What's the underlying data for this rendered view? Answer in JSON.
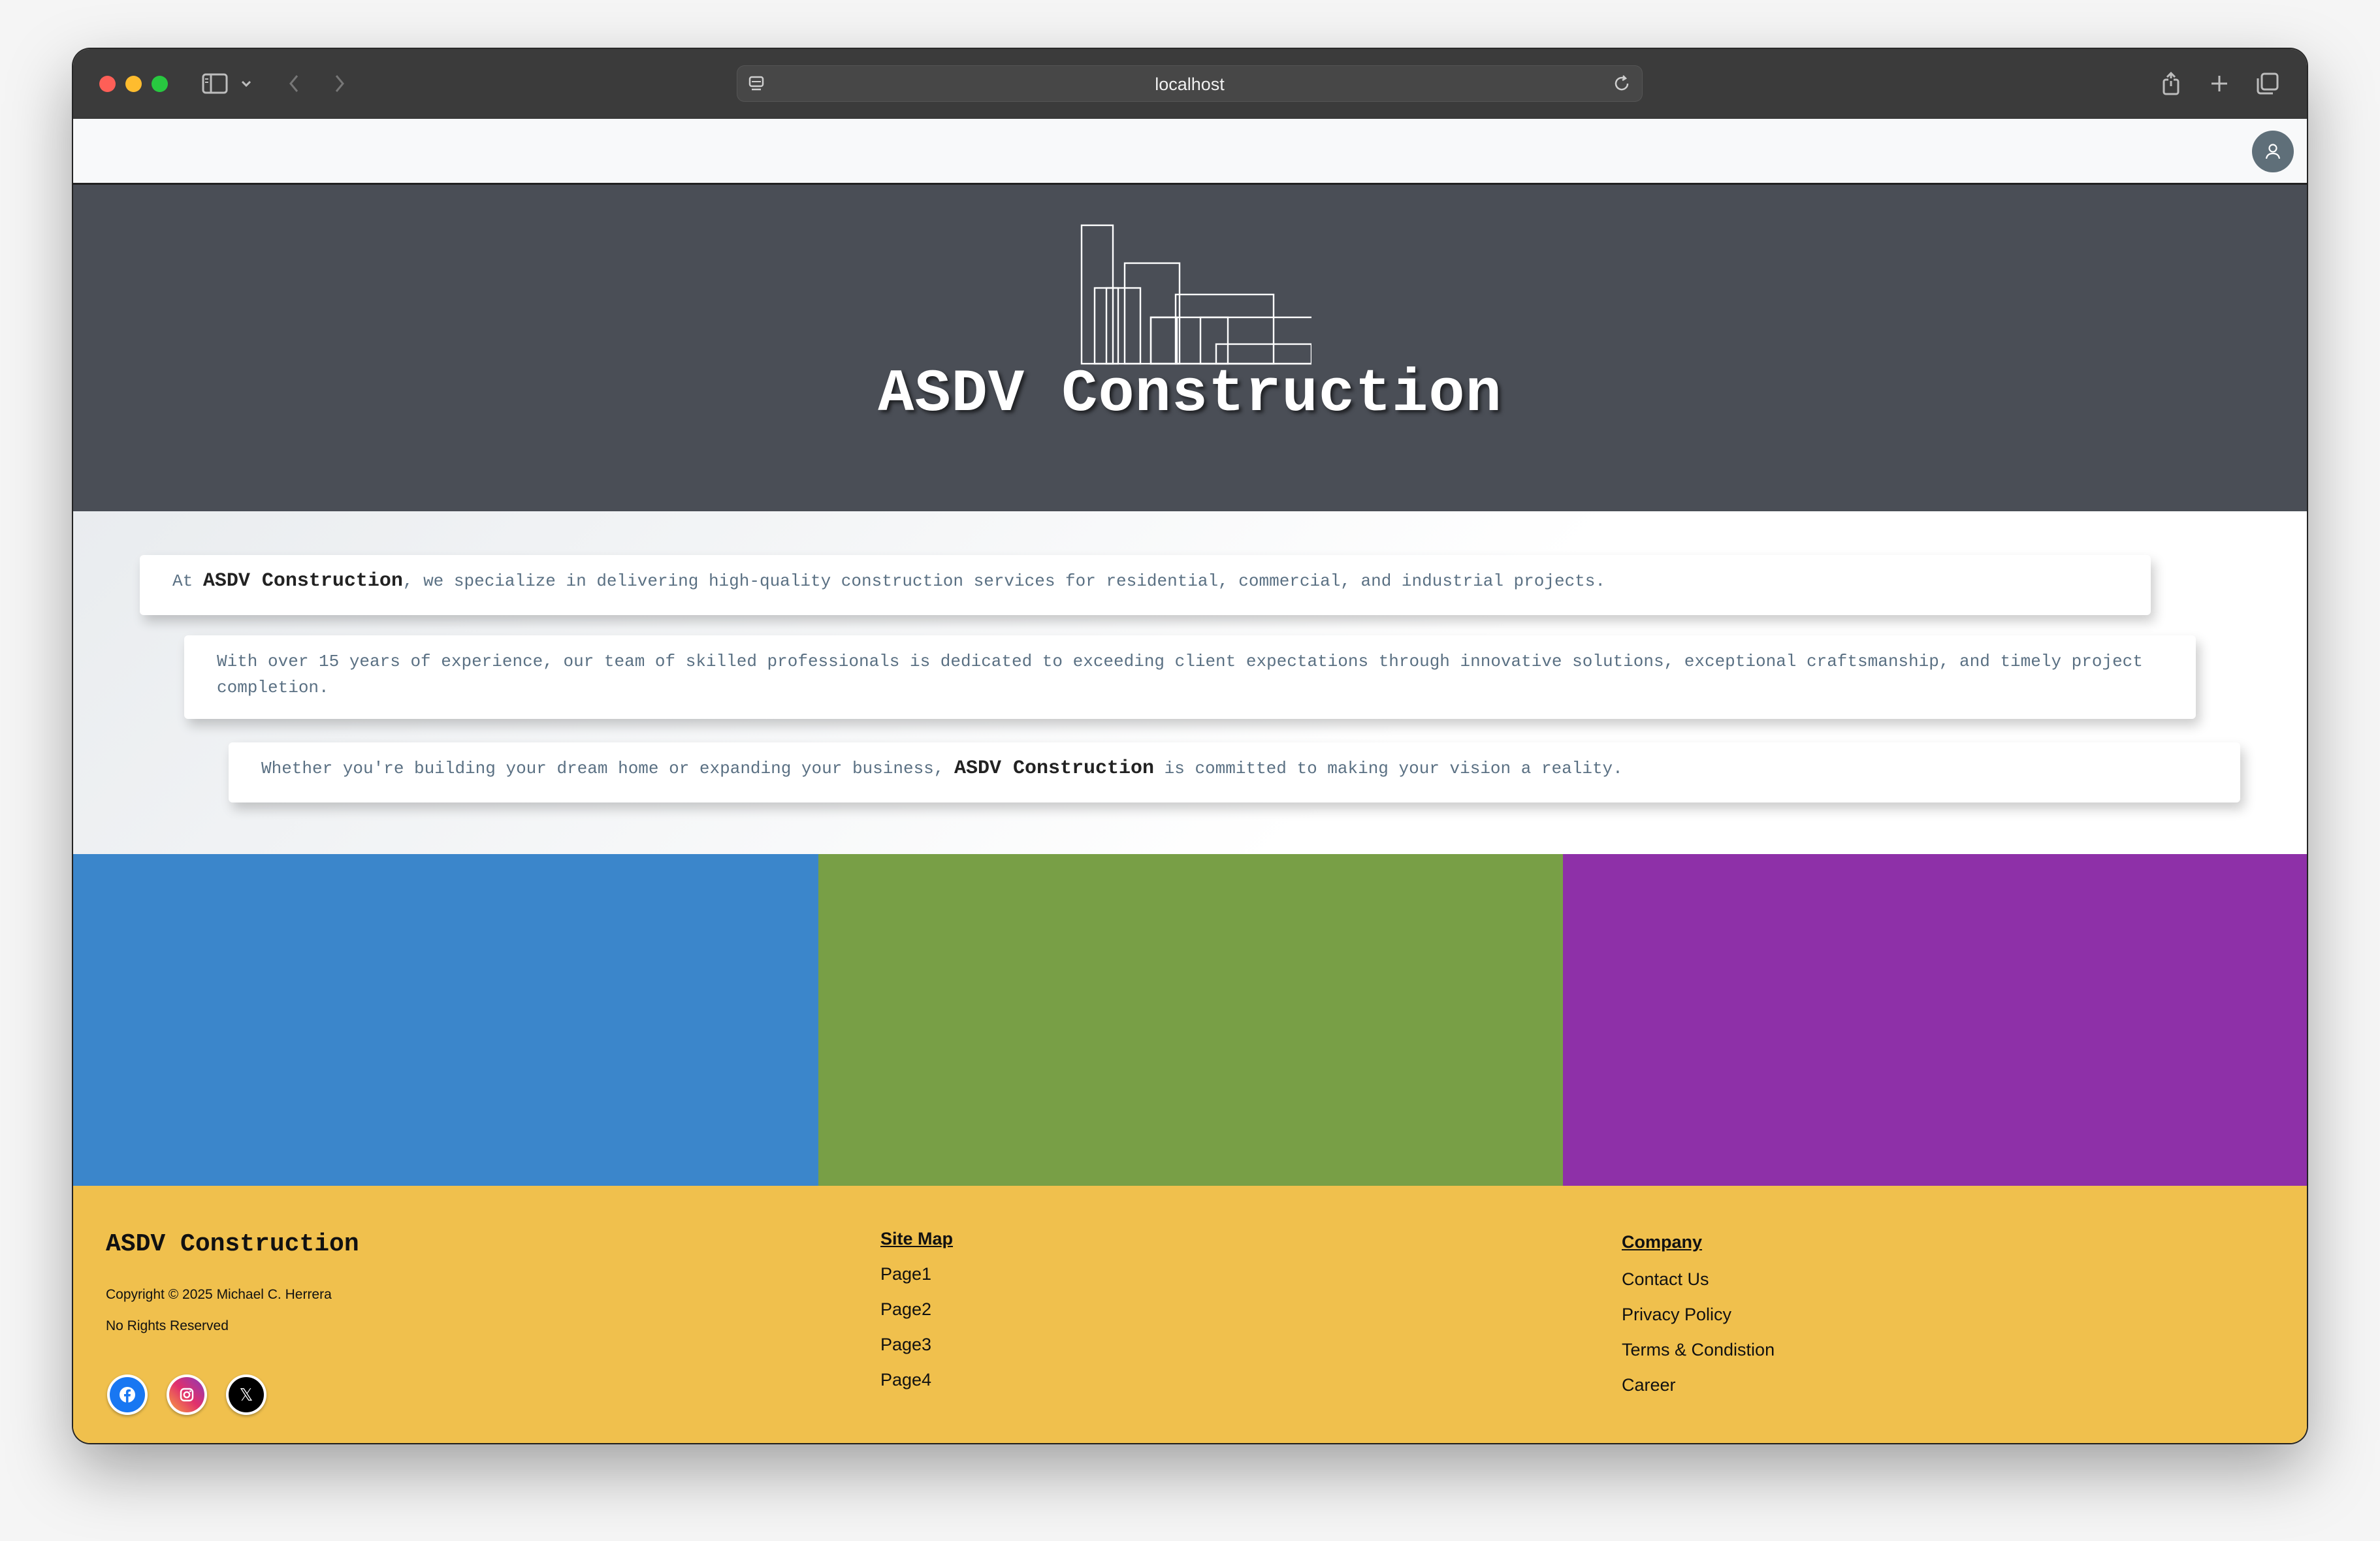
{
  "browser": {
    "url": "localhost"
  },
  "hero": {
    "title": "ASDV Construction"
  },
  "about": {
    "card1": {
      "pre": "At ",
      "brand": "ASDV Construction",
      "post": ", we specialize in delivering high-quality construction services for residential, commercial, and industrial projects."
    },
    "card2": {
      "text": "With over 15 years of experience, our team of skilled professionals is dedicated to exceeding client expectations through innovative solutions, exceptional craftsmanship, and timely project completion."
    },
    "card3": {
      "pre": "Whether you're building your dream home or expanding your business, ",
      "brand": "ASDV Construction",
      "post": " is committed to making your vision a reality."
    }
  },
  "panels": {
    "colors": [
      "#3b86cb",
      "#789f46",
      "#8e30a8"
    ]
  },
  "footer": {
    "brand": "ASDV Construction",
    "copyright": "Copyright © 2025 Michael C. Herrera",
    "rights": "No Rights Reserved",
    "social_icons": [
      "facebook-icon",
      "instagram-icon",
      "x-icon"
    ],
    "x_glyph": "𝕏",
    "sitemap": {
      "title": "Site Map",
      "links": [
        "Page1",
        "Page2",
        "Page3",
        "Page4"
      ]
    },
    "company": {
      "title": "Company",
      "links": [
        "Contact Us",
        "Privacy Policy",
        "Terms & Condistion",
        "Career"
      ]
    },
    "background": "#f0c04d"
  }
}
